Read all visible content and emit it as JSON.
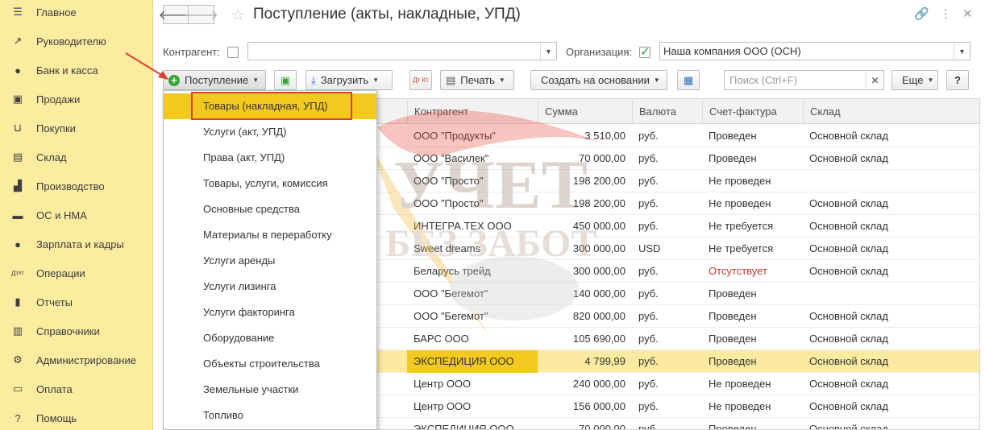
{
  "sidebar": {
    "items": [
      {
        "label": "Главное",
        "icon": "menu-icon"
      },
      {
        "label": "Руководителю",
        "icon": "trend-icon"
      },
      {
        "label": "Банк и касса",
        "icon": "coin-icon"
      },
      {
        "label": "Продажи",
        "icon": "bag-icon"
      },
      {
        "label": "Покупки",
        "icon": "cart-icon"
      },
      {
        "label": "Склад",
        "icon": "warehouse-icon"
      },
      {
        "label": "Производство",
        "icon": "factory-icon"
      },
      {
        "label": "ОС и НМА",
        "icon": "truck-icon"
      },
      {
        "label": "Зарплата и кадры",
        "icon": "person-icon"
      },
      {
        "label": "Операции",
        "icon": "dt-kt-icon"
      },
      {
        "label": "Отчеты",
        "icon": "bar-chart-icon"
      },
      {
        "label": "Справочники",
        "icon": "books-icon"
      },
      {
        "label": "Администрирование",
        "icon": "gear-icon"
      },
      {
        "label": "Оплата",
        "icon": "payment-icon"
      },
      {
        "label": "Помощь",
        "icon": "question-icon"
      }
    ]
  },
  "header": {
    "title": "Поступление (акты, накладные, УПД)"
  },
  "filters": {
    "kontragent_label": "Контрагент:",
    "kontragent_value": "",
    "organization_label": "Организация:",
    "organization_value": "Наша компания ООО (ОСН)"
  },
  "toolbar": {
    "postuplenie": "Поступление",
    "zagruzit": "Загрузить",
    "dt_kt": "Дт Кт",
    "pechat": "Печать",
    "sozdat": "Создать на основании",
    "search_placeholder": "Поиск (Ctrl+F)",
    "eshche": "Еще",
    "help": "?"
  },
  "dropdown": {
    "items": [
      "Товары (накладная, УПД)",
      "Услуги (акт, УПД)",
      "Права (акт, УПД)",
      "Товары, услуги, комиссия",
      "Основные средства",
      "Материалы в переработку",
      "Услуги аренды",
      "Услуги лизинга",
      "Услуги факторинга",
      "Оборудование",
      "Объекты строительства",
      "Земельные участки",
      "Топливо"
    ]
  },
  "table": {
    "columns": [
      "Контрагент",
      "Сумма",
      "Валюта",
      "Счет-фактура",
      "Склад"
    ],
    "rows": [
      {
        "kontr": "ООО \"Продукты\"",
        "sum": "3 510,00",
        "cur": "руб.",
        "sf": "Проведен",
        "sklad": "Основной склад"
      },
      {
        "kontr": "ООО \"Василек\"",
        "sum": "70 000,00",
        "cur": "руб.",
        "sf": "Проведен",
        "sklad": "Основной склад"
      },
      {
        "kontr": "ООО \"Просто\"",
        "sum": "198 200,00",
        "cur": "руб.",
        "sf": "Не проведен",
        "sklad": ""
      },
      {
        "kontr": "ООО \"Просто\"",
        "sum": "198 200,00",
        "cur": "руб.",
        "sf": "Не проведен",
        "sklad": "Основной склад"
      },
      {
        "kontr": "ИНТЕГРА.ТЕХ ООО",
        "sum": "450 000,00",
        "cur": "руб.",
        "sf": "Не требуется",
        "sklad": "Основной склад"
      },
      {
        "kontr": "Sweet dreams",
        "sum": "300 000,00",
        "cur": "USD",
        "sf": "Не требуется",
        "sklad": "Основной склад"
      },
      {
        "kontr": "Беларусь трейд",
        "sum": "300 000,00",
        "cur": "руб.",
        "sf": "Отсутствует",
        "sklad": "Основной склад"
      },
      {
        "kontr": "ООО \"Бегемот\"",
        "sum": "140 000,00",
        "cur": "руб.",
        "sf": "Проведен",
        "sklad": ""
      },
      {
        "kontr": "ООО \"Бегемот\"",
        "sum": "820 000,00",
        "cur": "руб.",
        "sf": "Проведен",
        "sklad": "Основной склад"
      },
      {
        "kontr": "БАРС ООО",
        "sum": "105 690,00",
        "cur": "руб.",
        "sf": "Проведен",
        "sklad": "Основной склад"
      },
      {
        "kontr": "ЭКСПЕДИЦИЯ ООО",
        "sum": "4 799,99",
        "cur": "руб.",
        "sf": "Проведен",
        "sklad": "Основной склад"
      },
      {
        "kontr": "Центр ООО",
        "sum": "240 000,00",
        "cur": "руб.",
        "sf": "Не проведен",
        "sklad": "Основной склад"
      },
      {
        "kontr": "Центр ООО",
        "sum": "156 000,00",
        "cur": "руб.",
        "sf": "Не проведен",
        "sklad": "Основной склад"
      },
      {
        "kontr": "ЭКСПЕДИЦИЯ ООО",
        "sum": "70 000,00",
        "cur": "руб.",
        "sf": "Проведен",
        "sklad": "Основной склад"
      }
    ]
  },
  "watermark": {
    "line1": "УЧЕТ",
    "line2": "БЕЗ ЗАБОТ"
  },
  "colors": {
    "sidebar_bg": "#fbeca0",
    "highlight": "#f4c91f",
    "selected_row": "#fbeaa0",
    "callout_border": "#d9412f",
    "status_red": "#c0392b"
  }
}
